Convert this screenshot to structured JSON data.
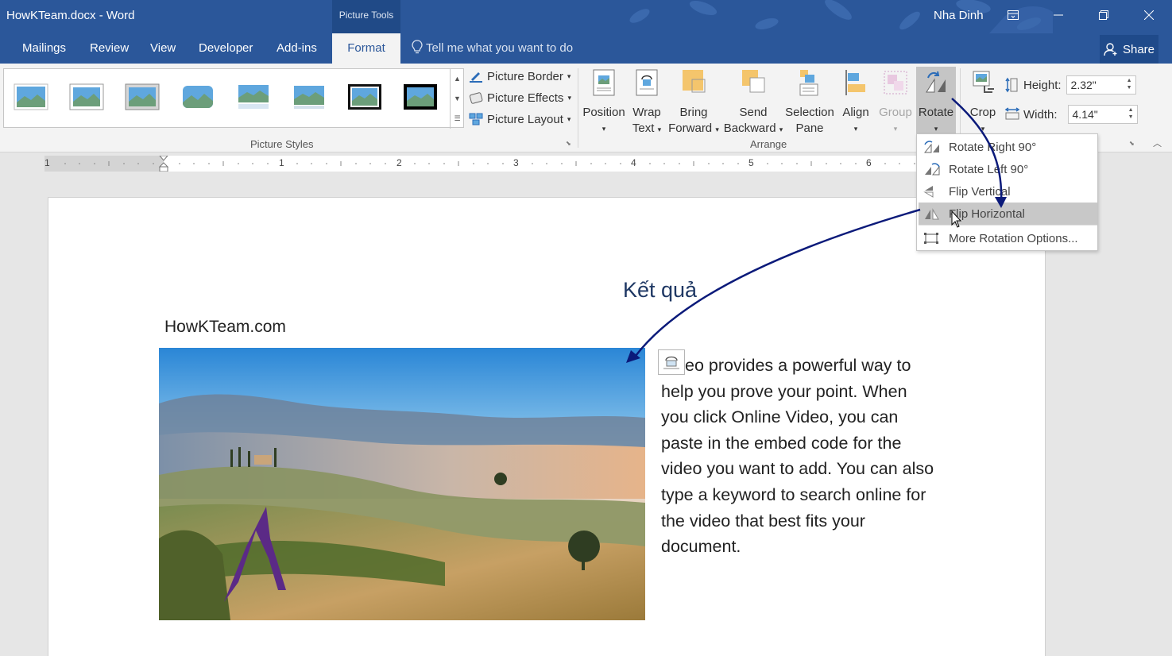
{
  "titlebar": {
    "doc_title": "HowKTeam.docx - Word",
    "context_group": "Picture Tools",
    "user": "Nha Dinh"
  },
  "tabs": [
    {
      "label": "Mailings"
    },
    {
      "label": "Review"
    },
    {
      "label": "View"
    },
    {
      "label": "Developer"
    },
    {
      "label": "Add-ins"
    },
    {
      "label": "Format",
      "active": true
    }
  ],
  "tell_me": "Tell me what you want to do",
  "share": "Share",
  "ribbon": {
    "picture_border": "Picture Border",
    "picture_effects": "Picture Effects",
    "picture_layout": "Picture Layout",
    "picture_styles_label": "Picture Styles",
    "arrange_label": "Arrange",
    "position": [
      "Position",
      ""
    ],
    "wrap_text": [
      "Wrap",
      "Text"
    ],
    "bring_forward": [
      "Bring",
      "Forward"
    ],
    "send_backward": [
      "Send",
      "Backward"
    ],
    "selection_pane": [
      "Selection",
      "Pane"
    ],
    "align": [
      "Align",
      ""
    ],
    "group": [
      "Group",
      ""
    ],
    "rotate": [
      "Rotate",
      ""
    ],
    "crop": [
      "Crop",
      ""
    ],
    "height_label": "Height:",
    "height_value": "2.32\"",
    "width_label": "Width:",
    "width_value": "4.14\""
  },
  "ruler": [
    "1",
    "1",
    "2",
    "3",
    "4",
    "5",
    "6"
  ],
  "rotate_menu": [
    {
      "label": "Rotate Right 90°",
      "icon": "rotate-right-icon"
    },
    {
      "label": "Rotate Left 90°",
      "icon": "rotate-left-icon"
    },
    {
      "label": "Flip Vertical",
      "icon": "flip-vertical-icon"
    },
    {
      "label": "Flip Horizontal",
      "icon": "flip-horizontal-icon",
      "highlighted": true
    },
    {
      "label": "More Rotation Options...",
      "icon": "more-rotation-icon"
    }
  ],
  "document": {
    "result_label": "Kết quả",
    "site_label": "HowKTeam.com",
    "body": "eo provides a powerful way to help you prove your point. When you click Online Video, you can paste in the embed code for the video you want to add. You can also type a keyword to search online for the video that best fits your document."
  },
  "colors": {
    "word_blue": "#2b579a",
    "arrow": "#0b1a7a",
    "logo_purple": "#5b2a86"
  }
}
